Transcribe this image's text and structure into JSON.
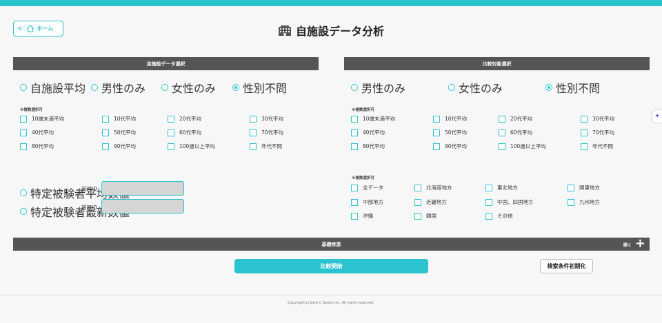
{
  "header": {
    "home_label": "ホーム",
    "title": "自施設データ分析"
  },
  "left": {
    "header": "自施設データ選択",
    "radios": [
      {
        "label": "自施設平均",
        "selected": false
      },
      {
        "label": "男性のみ",
        "selected": false
      },
      {
        "label": "女性のみ",
        "selected": false
      },
      {
        "label": "性別不問",
        "selected": true
      }
    ],
    "multi_note": "※複数選択可",
    "ages": [
      "10歳未満平均",
      "10代平均",
      "20代平均",
      "30代平均",
      "40代平均",
      "50代平均",
      "60代平均",
      "70代平均",
      "80代平均",
      "90代平均",
      "100歳以上平均",
      "年代不問"
    ],
    "subjects": [
      {
        "label": "特定被験者平均数値",
        "id_label": "管理ID"
      },
      {
        "label": "特定被験者最新数値",
        "id_label": "管理ID"
      }
    ]
  },
  "right": {
    "header": "比較対象選択",
    "radios": [
      {
        "label": "男性のみ",
        "selected": false
      },
      {
        "label": "女性のみ",
        "selected": false
      },
      {
        "label": "性別不問",
        "selected": true
      }
    ],
    "multi_note": "※複数選択可",
    "ages": [
      "10歳未満平均",
      "10代平均",
      "20代平均",
      "30代平均",
      "40代平均",
      "50代平均",
      "60代平均",
      "70代平均",
      "80代平均",
      "90代平均",
      "100歳以上平均",
      "年代不問"
    ],
    "region_note": "※複数選択可",
    "regions": [
      "全データ",
      "北海道地方",
      "東北地方",
      "関東地方",
      "中部地方",
      "近畿地方",
      "中国、四国地方",
      "九州地方",
      "沖縄",
      "韓国",
      "その他"
    ]
  },
  "kiso": {
    "label": "基礎疾患",
    "open_label": "開く",
    "plus": "+"
  },
  "actions": {
    "start": "比較開始",
    "reset": "検索条件初期化"
  },
  "footer": {
    "copyright": "Copyright(c) Zero C Seven,Inc. All rights reserved."
  },
  "side_tab_icon": "✦",
  "colors": {
    "accent": "#2bc3d0",
    "header_bg": "#555555",
    "input_bg": "#d5d5d5"
  }
}
